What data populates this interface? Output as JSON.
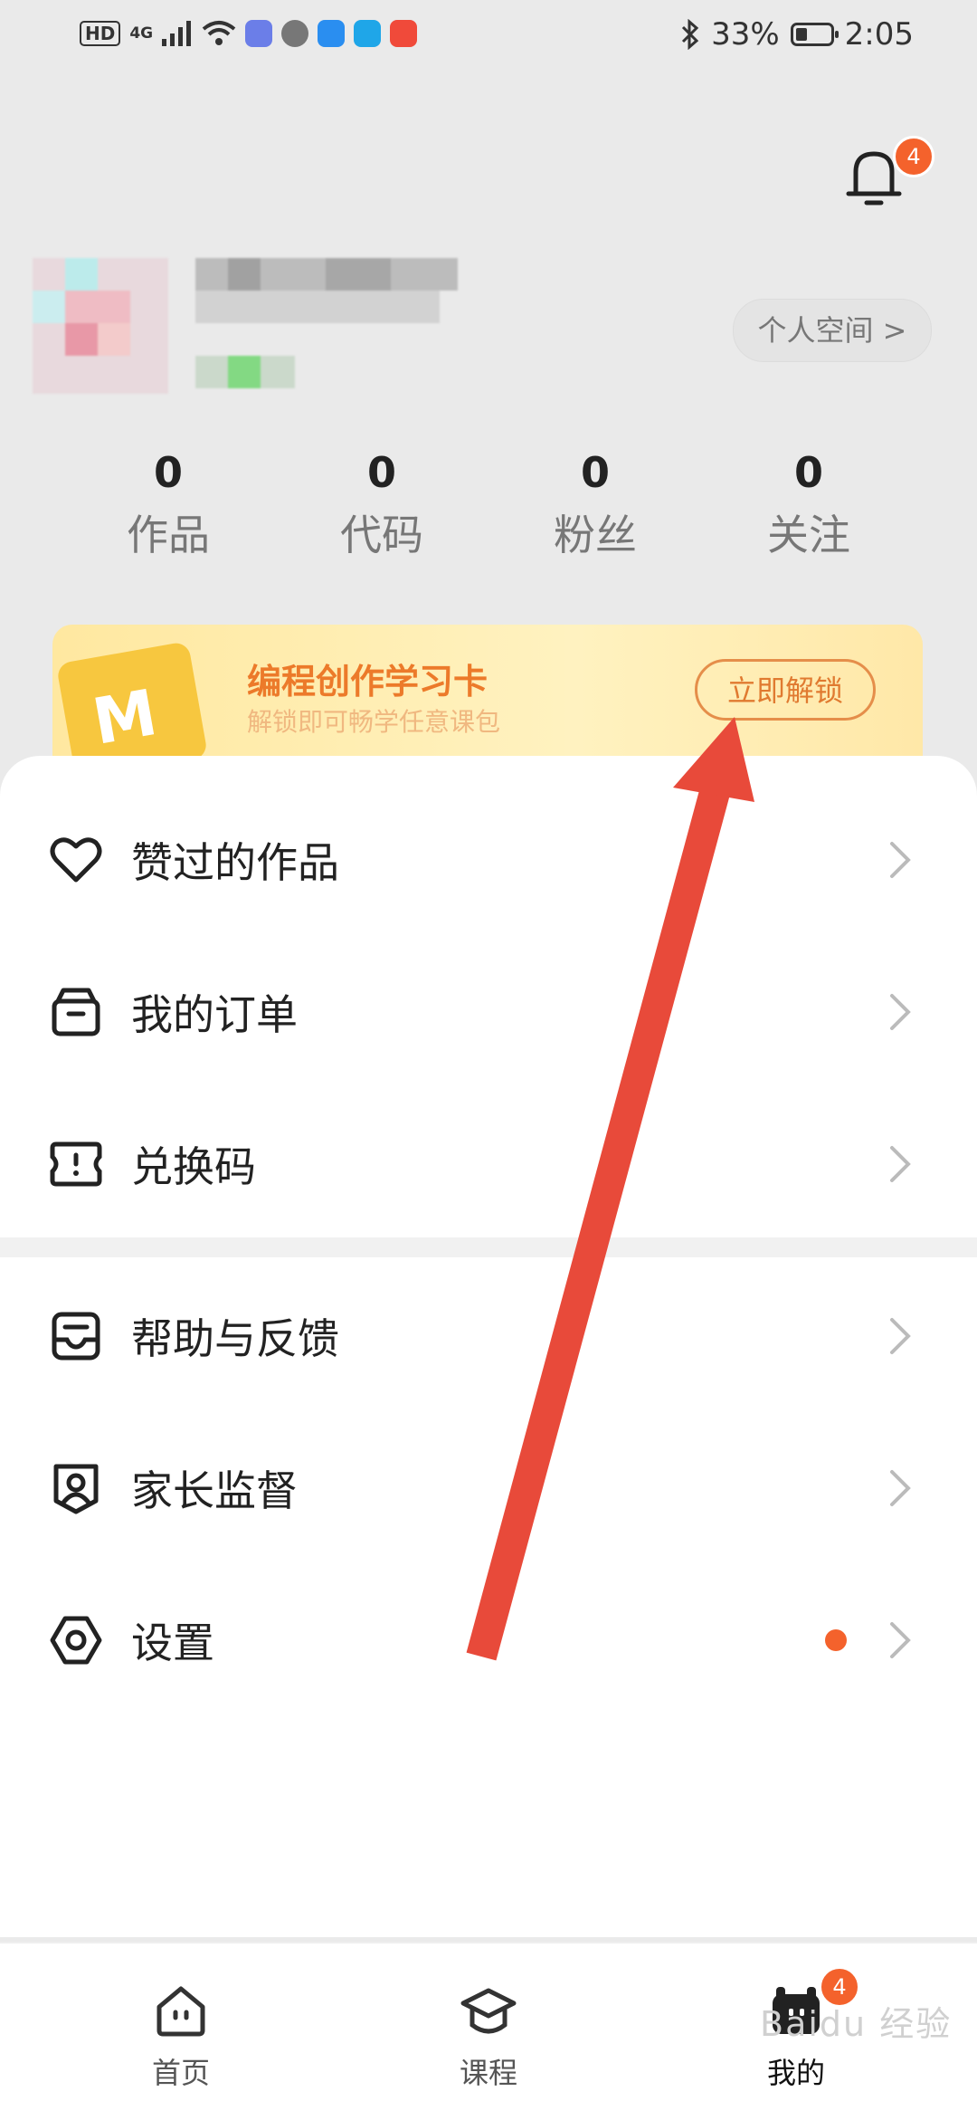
{
  "status_bar": {
    "hd": "HD",
    "network": "4G",
    "battery_percent": "33%",
    "battery_level": 0.33,
    "time": "2:05"
  },
  "header": {
    "notification_count": "4",
    "personal_space_label": "个人空间 >"
  },
  "stats": [
    {
      "value": "0",
      "label": "作品"
    },
    {
      "value": "0",
      "label": "代码"
    },
    {
      "value": "0",
      "label": "粉丝"
    },
    {
      "value": "0",
      "label": "关注"
    }
  ],
  "promo": {
    "card_letter": "M",
    "title": "编程创作学习卡",
    "subtitle": "解锁即可畅学任意课包",
    "button": "立即解锁"
  },
  "menu": [
    {
      "label": "赞过的作品",
      "icon": "heart-icon"
    },
    {
      "label": "我的订单",
      "icon": "box-icon"
    },
    {
      "label": "兑换码",
      "icon": "ticket-icon"
    },
    {
      "label": "帮助与反馈",
      "icon": "inbox-icon"
    },
    {
      "label": "家长监督",
      "icon": "parent-shield-icon"
    },
    {
      "label": "设置",
      "icon": "hexagon-gear-icon"
    }
  ],
  "bottom_nav": {
    "home": "首页",
    "courses": "课程",
    "mine": "我的",
    "mine_badge": "4"
  },
  "watermark": "Baidu 经验",
  "colors": {
    "accent": "#f4622c",
    "promo_title": "#ec7a2a",
    "annotation_arrow": "#e84a3a"
  }
}
